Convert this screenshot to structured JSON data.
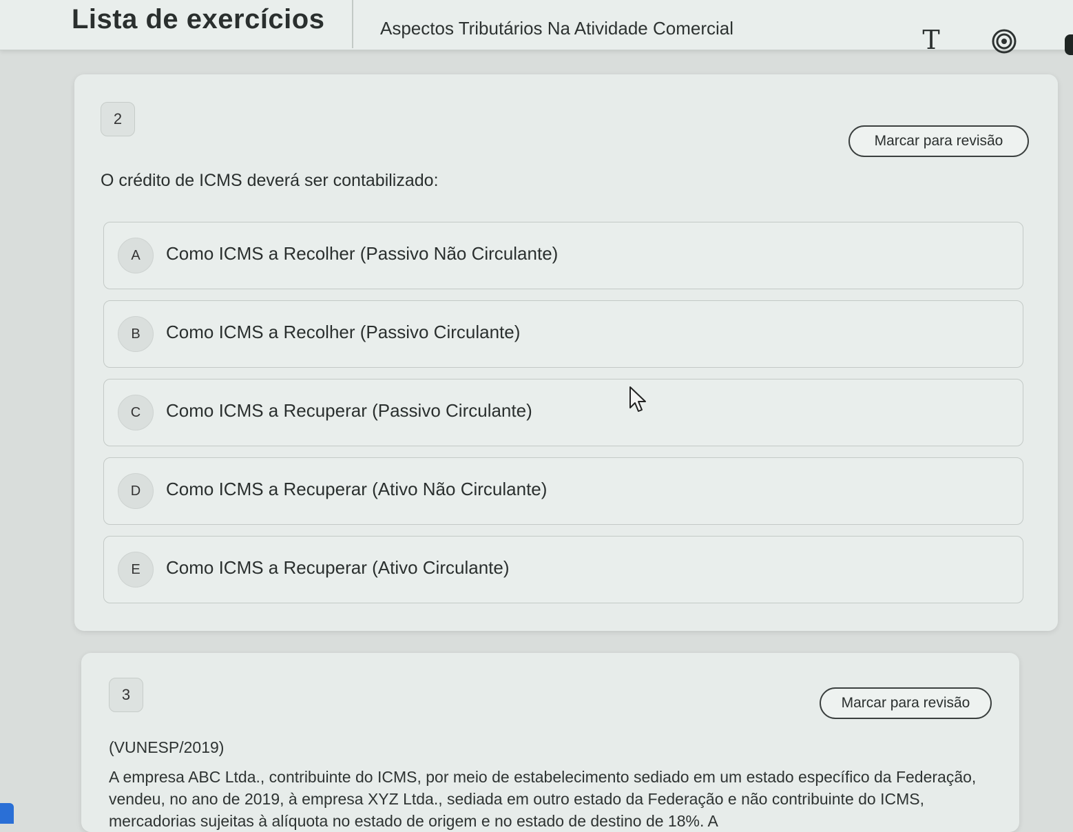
{
  "header": {
    "title": "Lista de exercícios",
    "subject": "Aspectos Tributários Na Atividade Comercial",
    "font_size_glyph": "T",
    "icons": [
      "font-size-icon",
      "target-icon"
    ]
  },
  "questions": [
    {
      "number": "2",
      "review_label": "Marcar para revisão",
      "prompt": "O crédito de ICMS deverá ser contabilizado:",
      "options": [
        {
          "letter": "A",
          "text": "Como ICMS a Recolher (Passivo Não Circulante)"
        },
        {
          "letter": "B",
          "text": "Como ICMS a Recolher (Passivo Circulante)"
        },
        {
          "letter": "C",
          "text": "Como ICMS a Recuperar (Passivo Circulante)"
        },
        {
          "letter": "D",
          "text": "Como ICMS a Recuperar (Ativo Não Circulante)"
        },
        {
          "letter": "E",
          "text": "Como ICMS a Recuperar (Ativo Circulante)"
        }
      ]
    },
    {
      "number": "3",
      "review_label": "Marcar para revisão",
      "source": "(VUNESP/2019)",
      "text": "A empresa ABC Ltda., contribuinte do ICMS, por meio de estabelecimento sediado em um estado específico da Federação, vendeu, no ano de 2019, à empresa XYZ Ltda., sediada em outro estado da Federação e não contribuinte do ICMS, mercadorias sujeitas à alíquota no estado de origem e no estado de destino de 18%. A"
    }
  ],
  "colors": {
    "background": "#d9dddb",
    "card": "#e7ecea",
    "text": "#2a2f2e",
    "accent_tab": "#2a6fd6"
  }
}
